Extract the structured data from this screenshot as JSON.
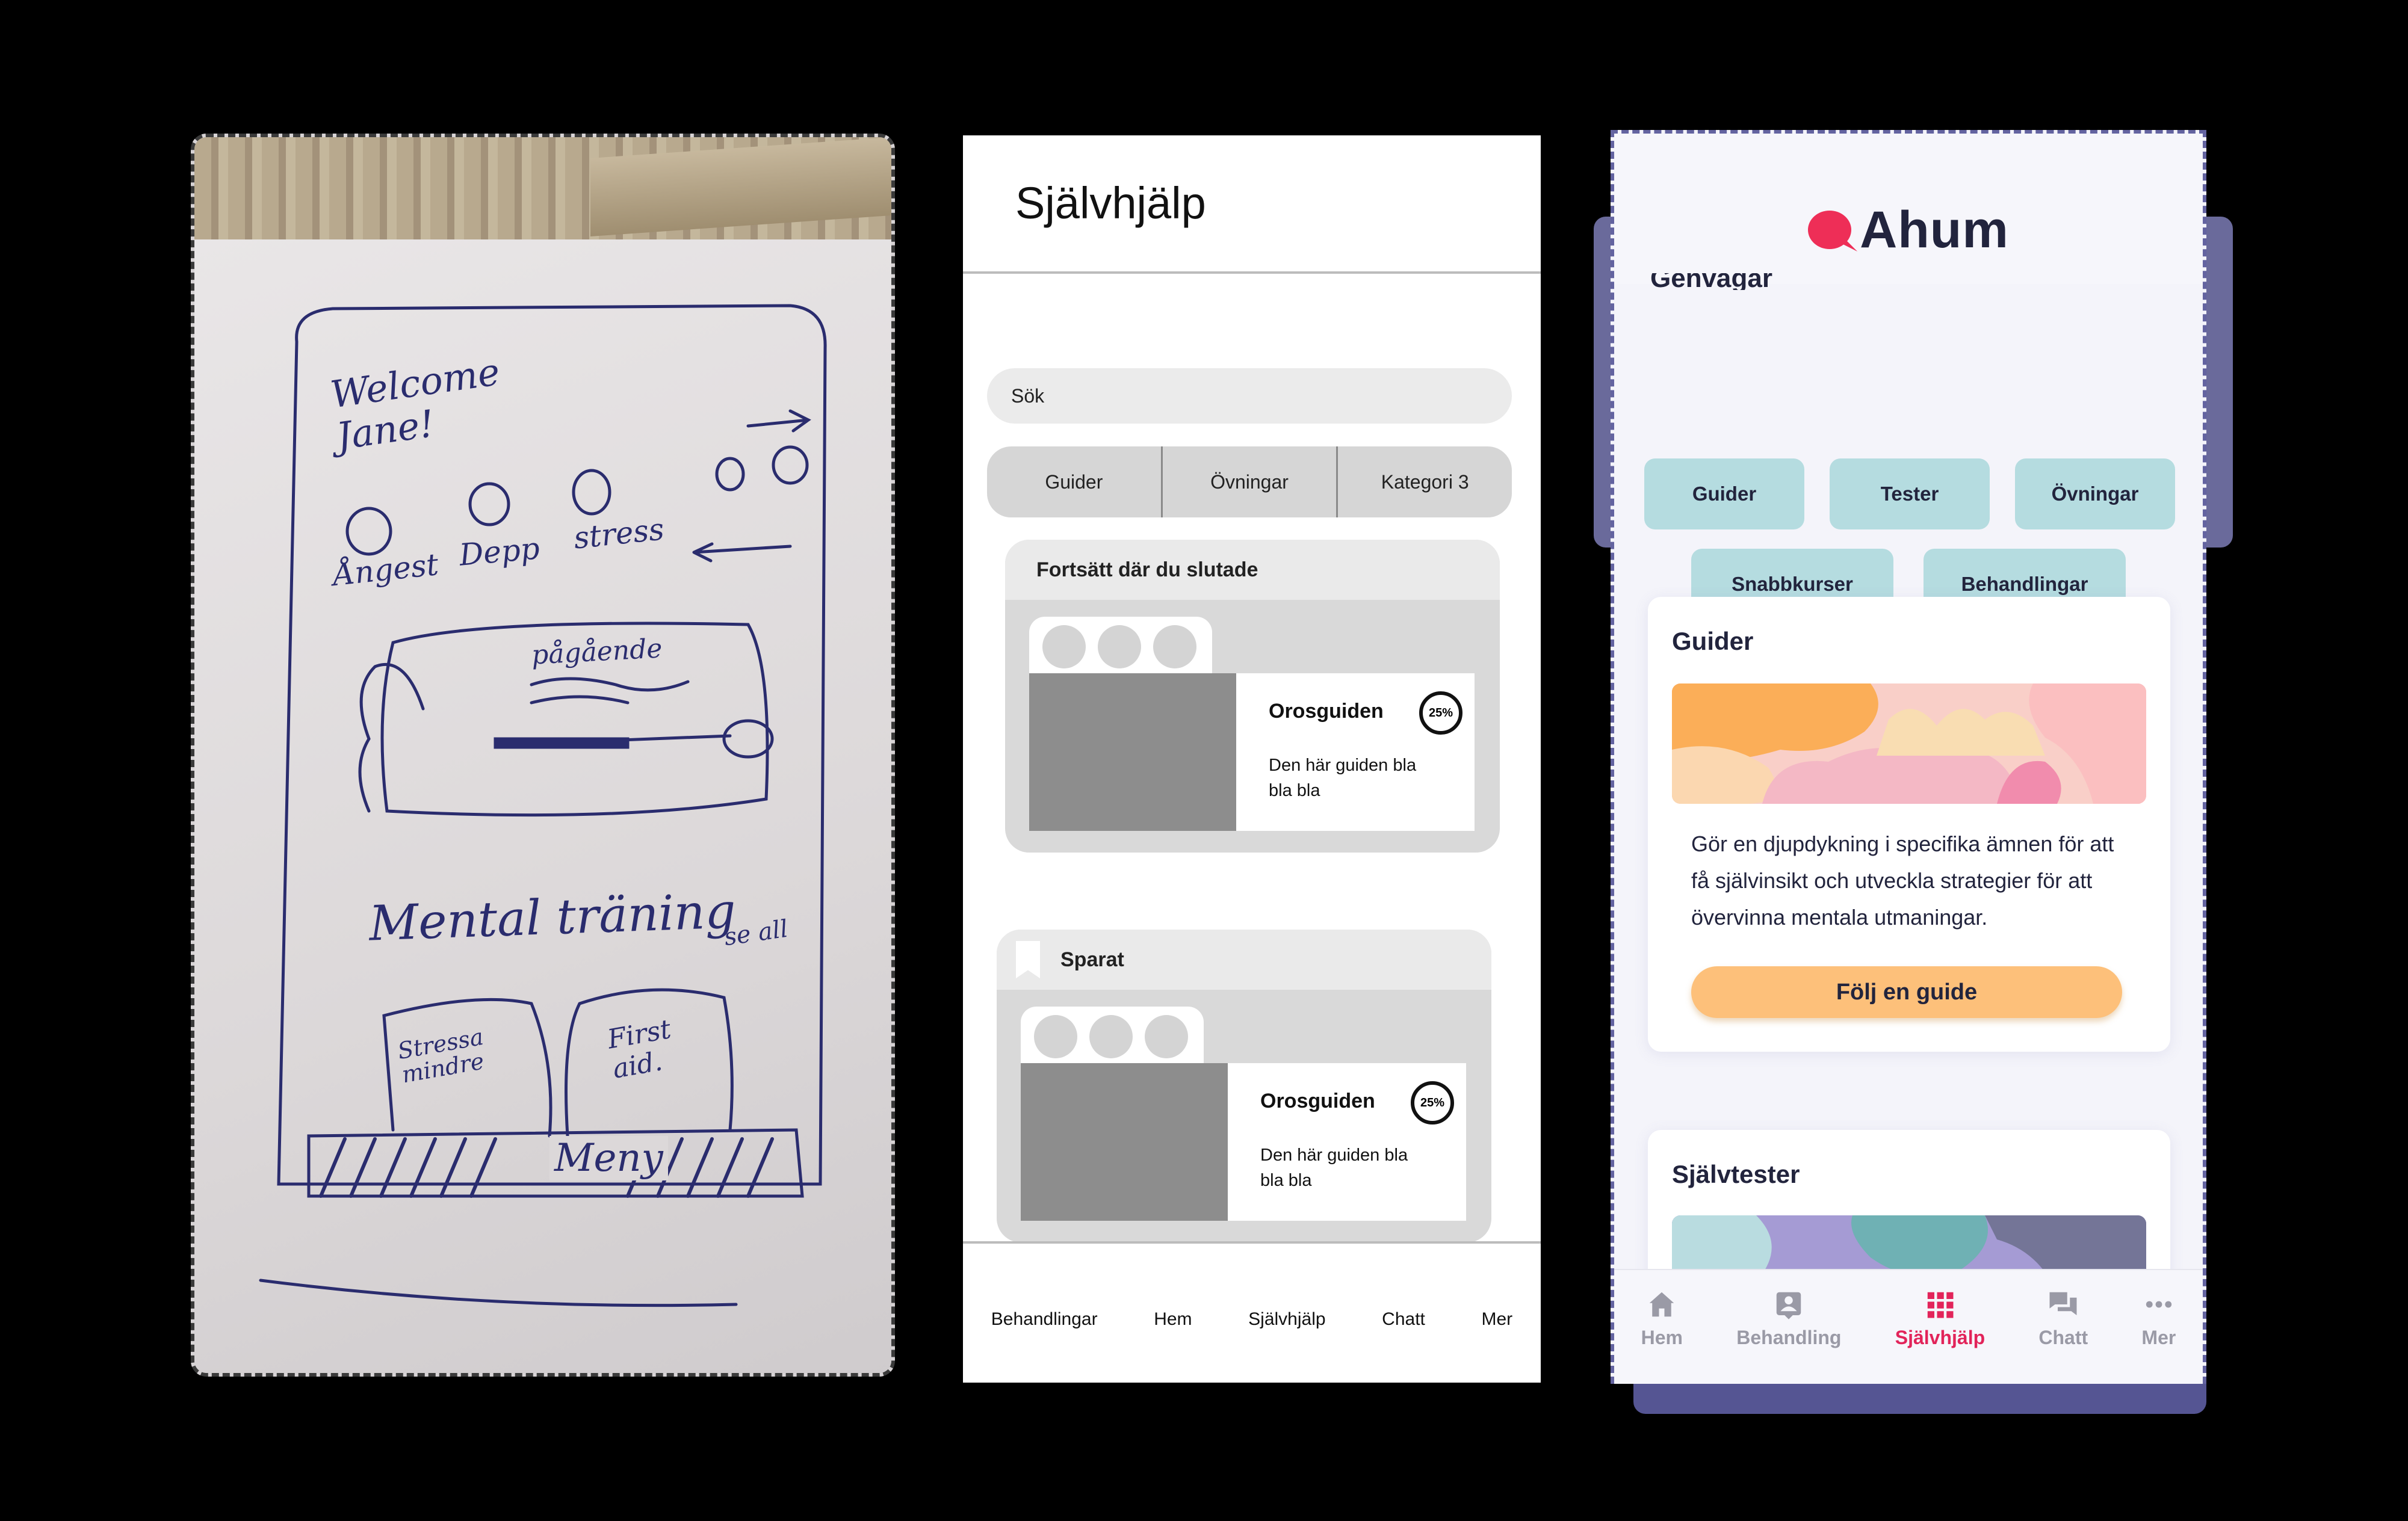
{
  "sketch": {
    "welcome": "Welcome Jane!",
    "categories": [
      "Ångest",
      "Depp",
      "stress"
    ],
    "ongoing": "pågående",
    "mental_training": "Mental träning",
    "see_all": "se all",
    "cards": [
      "Stressa mindre",
      "First aid."
    ],
    "menu": "Meny"
  },
  "wireframe": {
    "title": "Självhjälp",
    "search_placeholder": "Sök",
    "segments": [
      "Guider",
      "Övningar",
      "Kategori 3"
    ],
    "continue_card": {
      "header": "Fortsätt där du slutade",
      "guide_title": "Orosguiden",
      "progress": "25%",
      "description": "Den här guiden bla bla bla"
    },
    "saved_card": {
      "header": "Sparat",
      "guide_title": "Orosguiden",
      "progress": "25%",
      "description": "Den här guiden bla bla bla"
    },
    "nav": [
      "Behandlingar",
      "Hem",
      "Självhjälp",
      "Chatt",
      "Mer"
    ]
  },
  "app": {
    "logo_text": "Ahum",
    "brand_color": "#ee2e57",
    "accent_color": "#e2245a",
    "shortcuts_title": "Genvägar",
    "shortcuts": [
      "Guider",
      "Tester",
      "Övningar",
      "Snabbkurser",
      "Behandlingar"
    ],
    "guides_card": {
      "title": "Guider",
      "text": "Gör en djupdykning i specifika ämnen för att få självinsikt och utveckla strategier för att övervinna mentala utmaningar.",
      "button": "Följ en guide"
    },
    "tests_card": {
      "title": "Självtester"
    },
    "tabs": [
      {
        "label": "Hem",
        "icon": "home-icon"
      },
      {
        "label": "Behandling",
        "icon": "contact-card-icon"
      },
      {
        "label": "Självhjälp",
        "icon": "grid-icon"
      },
      {
        "label": "Chatt",
        "icon": "chat-bubbles-icon"
      },
      {
        "label": "Mer",
        "icon": "more-dots-icon"
      }
    ],
    "active_tab": "Självhjälp"
  }
}
